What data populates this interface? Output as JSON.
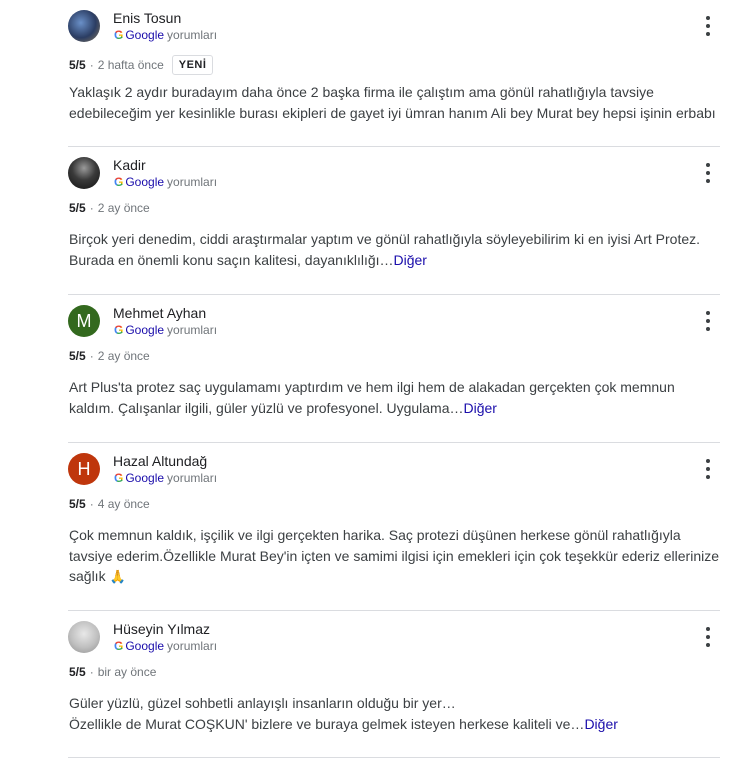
{
  "source": {
    "g": "G",
    "google": "Google",
    "suffix": "yorumları"
  },
  "reviews": [
    {
      "name": "Enis Tosun",
      "rating": "5/5",
      "time": "2 hafta önce",
      "badge": "YENİ",
      "text": "Yaklaşık 2 aydır buradayım daha önce 2 başka firma ile çalıştım ama gönül rahatlığıyla tavsiye edebileceğim yer kesinlikle burası ekipleri de gayet iyi ümran hanım Ali bey Murat bey hepsi işinin erbabı"
    },
    {
      "name": "Kadir",
      "rating": "5/5",
      "time": "2 ay önce",
      "text": "Birçok yeri denedim, ciddi araştırmalar yaptım ve gönül rahatlığıyla söyleyebilirim ki en iyisi Art Protez. Burada en önemli konu saçın kalitesi, dayanıklılığı…",
      "more": "Diğer"
    },
    {
      "name": "Mehmet Ayhan",
      "initial": "M",
      "rating": "5/5",
      "time": "2 ay önce",
      "text": "Art Plus'ta protez saç uygulamamı yaptırdım ve hem ilgi hem de alakadan gerçekten çok memnun kaldım. Çalışanlar ilgili, güler yüzlü ve profesyonel. Uygulama…",
      "more": "Diğer"
    },
    {
      "name": "Hazal Altundağ",
      "initial": "H",
      "rating": "5/5",
      "time": "4 ay önce",
      "text": "Çok memnun kaldık, işçilik ve ilgi gerçekten harika. Saç protezi düşünen herkese gönül rahatlığıyla tavsiye ederim.Özellikle Murat Bey'in içten ve samimi ilgisi için emekleri için çok teşekkür ederiz ellerinize sağlık",
      "emoji": "🙏"
    },
    {
      "name": "Hüseyin Yılmaz",
      "rating": "5/5",
      "time": "bir ay önce",
      "text_line1": "Güler yüzlü, güzel sohbetli anlayışlı insanların olduğu bir yer…",
      "text_line2": "Özellikle de Murat COŞKUN' bizlere ve buraya gelmek isteyen herkese kaliteli ve…",
      "more": "Diğer"
    }
  ]
}
